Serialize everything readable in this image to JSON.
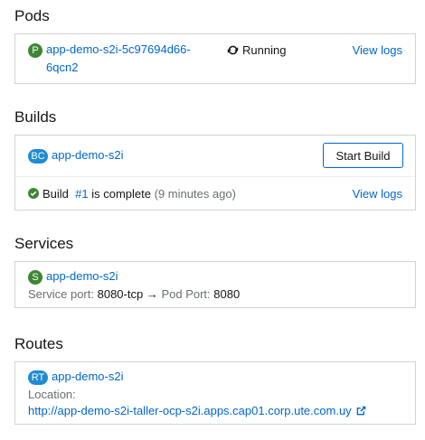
{
  "pods": {
    "title": "Pods",
    "badge": "P",
    "badge_color": "#3e8635",
    "name_line1": "app-demo-s2i-5c97694d66-",
    "name_line2": "6qcn2",
    "status_icon": "sync-icon",
    "status": "Running",
    "view_logs": "View logs"
  },
  "builds": {
    "title": "Builds",
    "badge": "BC",
    "badge_color": "#1f8bd6",
    "name": "app-demo-s2i",
    "start_button": "Start Build",
    "status_icon": "check-circle-icon",
    "build_prefix": "Build",
    "build_number": "#1",
    "build_status": "is complete",
    "build_time": "(9 minutes ago)",
    "view_logs": "View logs"
  },
  "services": {
    "title": "Services",
    "badge": "S",
    "badge_color": "#3e8635",
    "name": "app-demo-s2i",
    "service_port_label": "Service port:",
    "service_port_value": "8080-tcp",
    "arrow": "→",
    "pod_port_label": "Pod Port:",
    "pod_port_value": "8080"
  },
  "routes": {
    "title": "Routes",
    "badge": "RT",
    "badge_color": "#1f8bd6",
    "name": "app-demo-s2i",
    "location_label": "Location:",
    "url": "http://app-demo-s2i-taller-ocp-s2i.apps.cap01.corp.ute.com.uy",
    "external_icon": "external-link-icon"
  }
}
